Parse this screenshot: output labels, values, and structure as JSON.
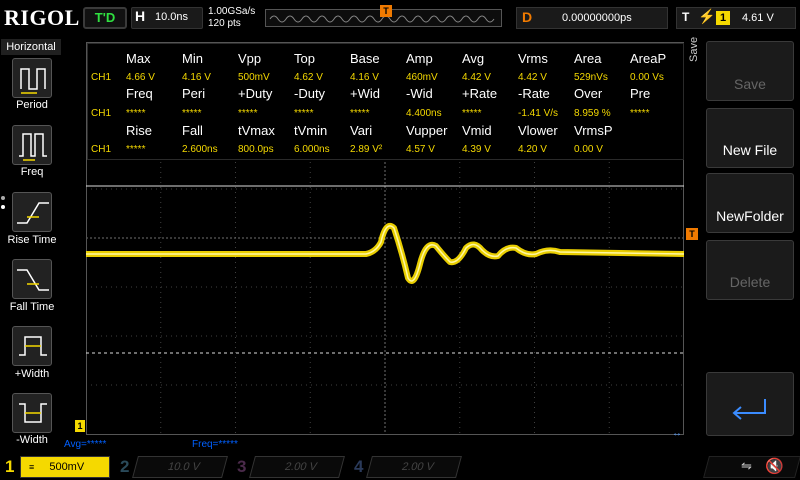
{
  "topbar": {
    "logo": "RIGOL",
    "trigger_status": "T'D",
    "timebase_letter": "H",
    "timebase_value": "10.0ns",
    "sample_rate": "1.00GSa/s",
    "memory_points": "120 pts",
    "delay_letter": "D",
    "delay_value": "0.00000000ps",
    "trigger_letter": "T",
    "trigger_source": "1",
    "trigger_level": "4.61 V"
  },
  "left_menu": {
    "title": "Horizontal",
    "items": [
      {
        "label": "Period",
        "icon": "period-icon"
      },
      {
        "label": "Freq",
        "icon": "frequency-icon"
      },
      {
        "label": "Rise Time",
        "icon": "rise-time-icon"
      },
      {
        "label": "Fall Time",
        "icon": "fall-time-icon"
      },
      {
        "label": "+Width",
        "icon": "positive-width-icon"
      },
      {
        "label": "-Width",
        "icon": "negative-width-icon"
      }
    ]
  },
  "measurements": {
    "channel": "CH1",
    "rows": [
      {
        "headers": [
          "Max",
          "Min",
          "Vpp",
          "Top",
          "Base",
          "Amp",
          "Avg",
          "Vrms",
          "Area",
          "AreaP"
        ],
        "values": [
          "4.66 V",
          "4.16 V",
          "500mV",
          "4.62 V",
          "4.16 V",
          "460mV",
          "4.42 V",
          "4.42 V",
          "529nVs",
          "0.00 Vs"
        ]
      },
      {
        "headers": [
          "Freq",
          "Peri",
          "+Duty",
          "-Duty",
          "+Wid",
          "-Wid",
          "+Rate",
          "-Rate",
          "Over",
          "Pre"
        ],
        "values": [
          "*****",
          "*****",
          "*****",
          "*****",
          "*****",
          "4.400ns",
          "*****",
          "-1.41 V/s",
          "8.959 %",
          "*****"
        ]
      },
      {
        "headers": [
          "Rise",
          "Fall",
          "tVmax",
          "tVmin",
          "Vari",
          "Vupper",
          "Vmid",
          "Vlower",
          "VrmsP",
          ""
        ],
        "values": [
          "*****",
          "2.600ns",
          "800.0ps",
          "6.000ns",
          "2.89 V²",
          "4.57 V",
          "4.39 V",
          "4.20 V",
          "0.00 V",
          ""
        ]
      }
    ]
  },
  "status": {
    "avg": "Avg=*****",
    "freq": "Freq=*****"
  },
  "right_menu": {
    "tab_label": "Save",
    "buttons": [
      {
        "label": "Save",
        "enabled": false
      },
      {
        "label": "New File",
        "enabled": true
      },
      {
        "label": "NewFolder",
        "enabled": true
      },
      {
        "label": "Delete",
        "enabled": false
      }
    ],
    "enter_icon": "enter-arrow-icon"
  },
  "channels": [
    {
      "num": "1",
      "scale": "500mV",
      "color": "#f5d900",
      "active": true
    },
    {
      "num": "2",
      "scale": "10.0 V",
      "color": "#00c8ff",
      "active": false
    },
    {
      "num": "3",
      "scale": "2.00 V",
      "color": "#ff2aff",
      "active": false
    },
    {
      "num": "4",
      "scale": "2.00 V",
      "color": "#3b7cff",
      "active": false
    }
  ],
  "colors": {
    "ch1": "#f5d900",
    "trigger": "#f07a00",
    "status_blue": "#0060ff",
    "trig_status_green": "#2fe040"
  }
}
